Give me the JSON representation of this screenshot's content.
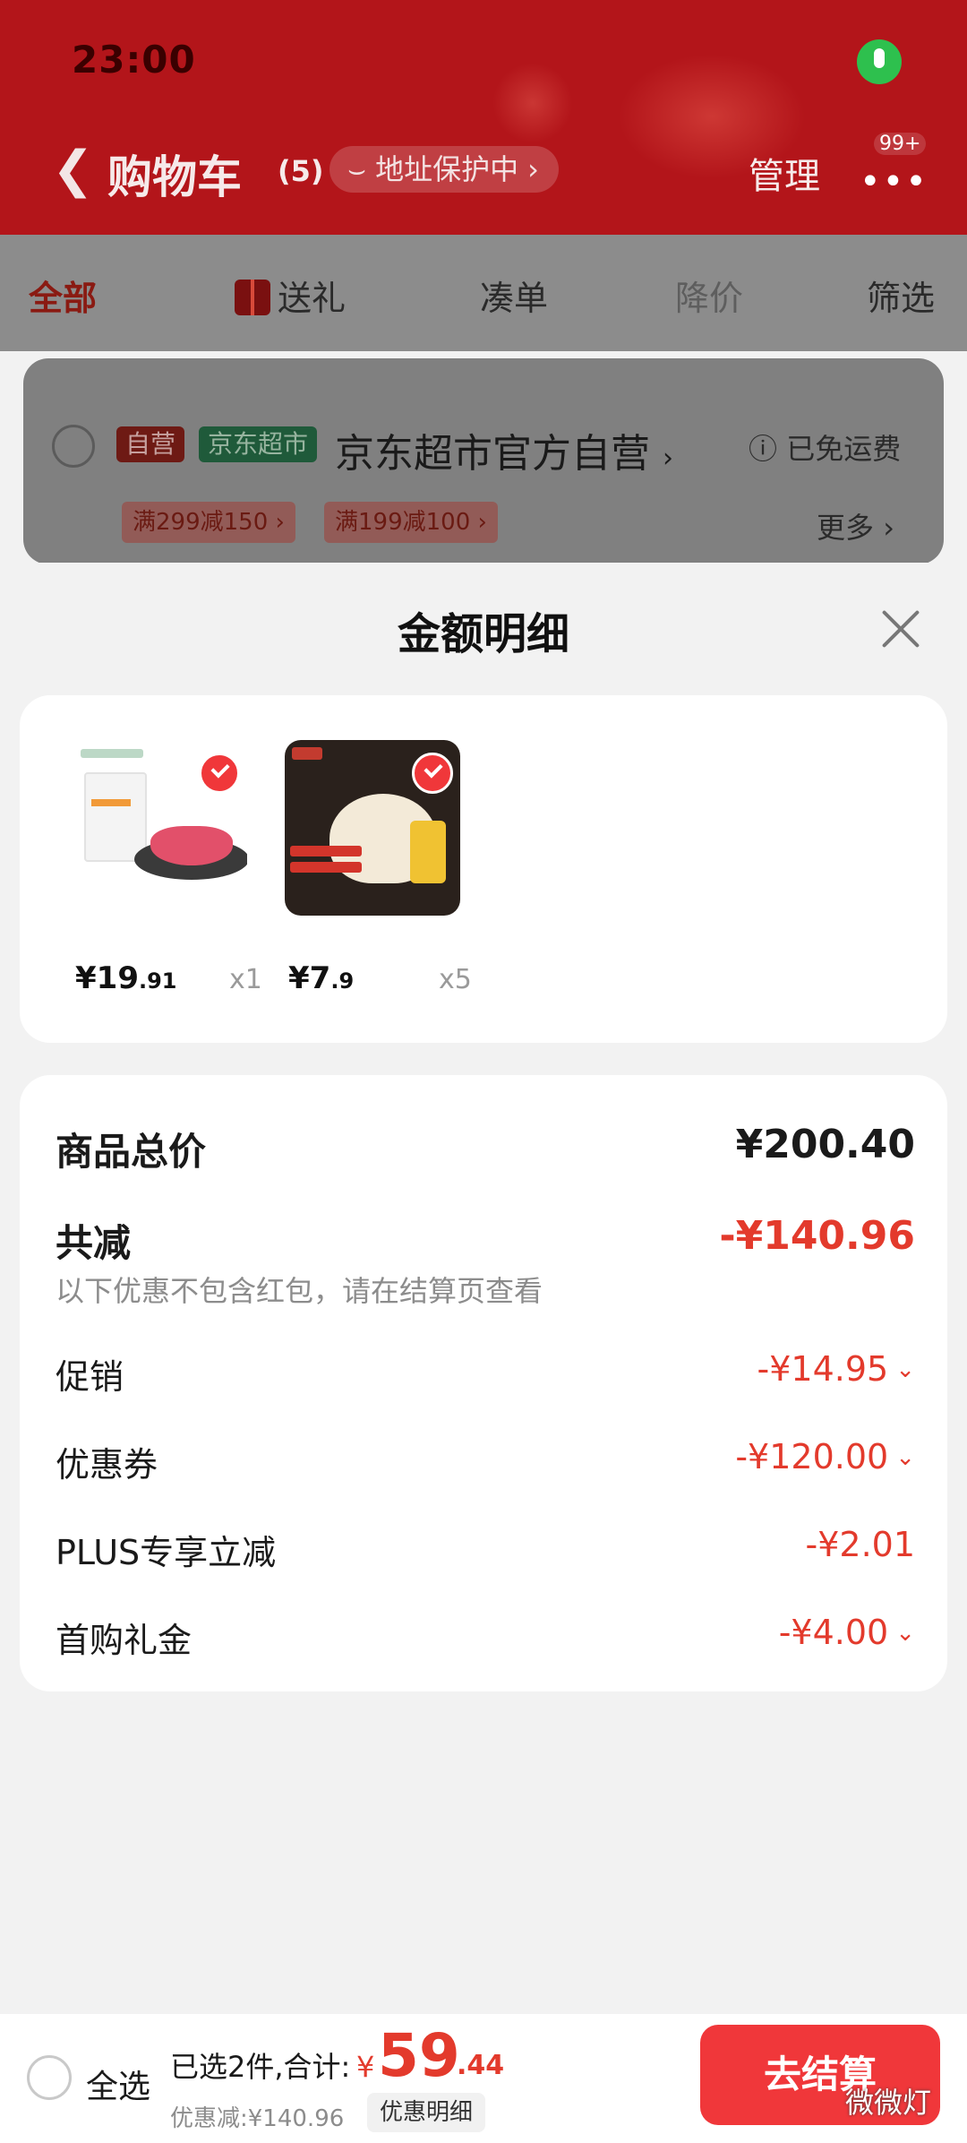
{
  "status_bar": {
    "time": "23:00"
  },
  "header": {
    "title": "购物车",
    "count": "(5)",
    "address_protect": "地址保护中",
    "manage": "管理",
    "more_badge": "99+"
  },
  "tabs": [
    {
      "label": "全部",
      "state": "active"
    },
    {
      "label": "送礼",
      "state": "normal"
    },
    {
      "label": "凑单",
      "state": "normal"
    },
    {
      "label": "降价",
      "state": "disabled"
    },
    {
      "label": "筛选",
      "state": "normal"
    }
  ],
  "store": {
    "tag_self": "自营",
    "tag_market": "京东超市",
    "name": "京东超市官方自营",
    "shipping": "已免运费",
    "promos": [
      "满299减150",
      "满199减100"
    ],
    "more": "更多"
  },
  "sheet": {
    "title": "金额明细",
    "products": [
      {
        "price_int": "¥19",
        "price_dec": ".91",
        "qty": "x1"
      },
      {
        "price_int": "¥7",
        "price_dec": ".9",
        "qty": "x5"
      }
    ],
    "total_label": "商品总价",
    "total_value": "¥200.40",
    "reduce_label": "共减",
    "reduce_value": "-¥140.96",
    "note": "以下优惠不包含红包，请在结算页查看",
    "items": [
      {
        "label": "促销",
        "value": "-¥14.95"
      },
      {
        "label": "优惠券",
        "value": "-¥120.00"
      },
      {
        "label": "PLUS专享立减",
        "value": "-¥2.01"
      },
      {
        "label": "首购礼金",
        "value": "-¥4.00"
      }
    ]
  },
  "bottom_bar": {
    "select_all": "全选",
    "selected_summary": "已选2件,合计:",
    "currency": "¥",
    "total_int": "59",
    "total_dec": ".44",
    "discount": "优惠减:¥140.96",
    "detail_link": "优惠明细",
    "checkout": "去结算"
  },
  "watermark": "微微灯",
  "colors": {
    "accent_red": "#e33a2c",
    "header_red": "#b3151a",
    "checkout_red": "#f0373a"
  }
}
